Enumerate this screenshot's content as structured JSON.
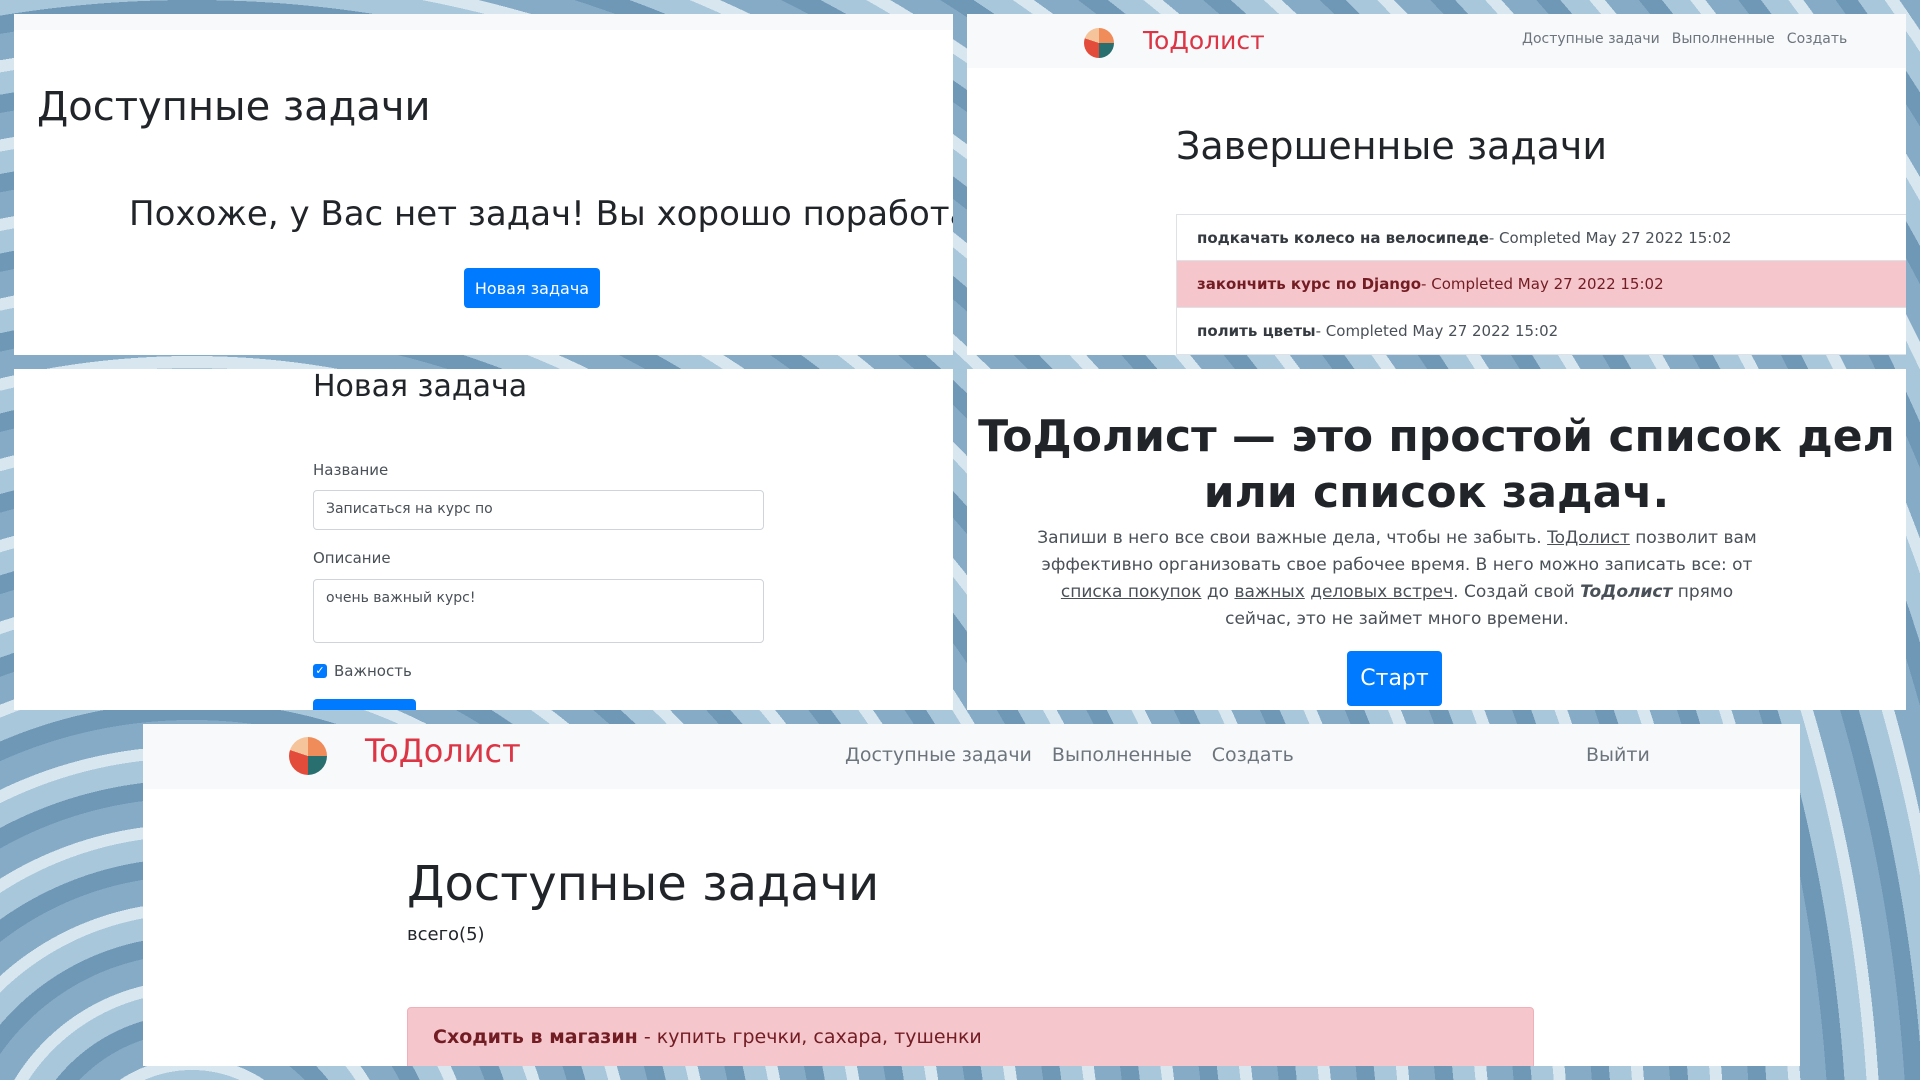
{
  "panel_available_empty": {
    "title": "Доступные задачи",
    "empty_message": "Похоже, у Вас нет задач! Вы хорошо поработали!",
    "new_task_button": "Новая задача"
  },
  "panel_completed": {
    "brand": "ToДолист",
    "nav": [
      "Доступные задачи",
      "Выполненные",
      "Создать"
    ],
    "title": "Завершенные задачи",
    "items": [
      {
        "name": "подкачать колесо на велосипеде",
        "status": " - Completed May 27 2022 15:02",
        "highlight": false
      },
      {
        "name": "закончить курс по Django",
        "status": " - Completed May 27 2022 15:02",
        "highlight": true
      },
      {
        "name": "полить цветы",
        "status": " - Completed May 27 2022 15:02",
        "highlight": false
      }
    ]
  },
  "panel_new_task": {
    "title": "Новая задача",
    "name_label": "Название",
    "name_value": "Записаться на курс по",
    "description_label": "Описание",
    "description_value": "очень важный курс!",
    "importance_label": "Важность",
    "importance_checked": true
  },
  "panel_landing": {
    "headline": "ToДолист — это простой список дел или список задач.",
    "text_parts": {
      "a": "Запиши в него все свои важные дела, чтобы не забыть. ",
      "b": "ToДолист",
      "c": " позволит вам эффективно организовать свое рабочее время. В него можно записать все: от ",
      "d": "списка покупок",
      "e": " до ",
      "f": "важных",
      "g": " ",
      "h": "деловых встреч",
      "i": ". Создай свой ",
      "j": "ToДолист",
      "k": " прямо сейчас, это не займет много времени."
    },
    "start_button": "Старт"
  },
  "panel_main": {
    "brand": "ToДолист",
    "nav": [
      "Доступные задачи",
      "Выполненные",
      "Создать"
    ],
    "logout": "Выйти",
    "title": "Доступные задачи",
    "count": "всего(5)",
    "first_task": {
      "name": "Сходить в магазин",
      "desc": " - купить гречки, сахара, тушенки"
    }
  },
  "colors": {
    "primary": "#007bff",
    "brand": "#dc3545",
    "danger_bg": "#f5c6cb",
    "navbar_bg": "#f8f9fa"
  }
}
